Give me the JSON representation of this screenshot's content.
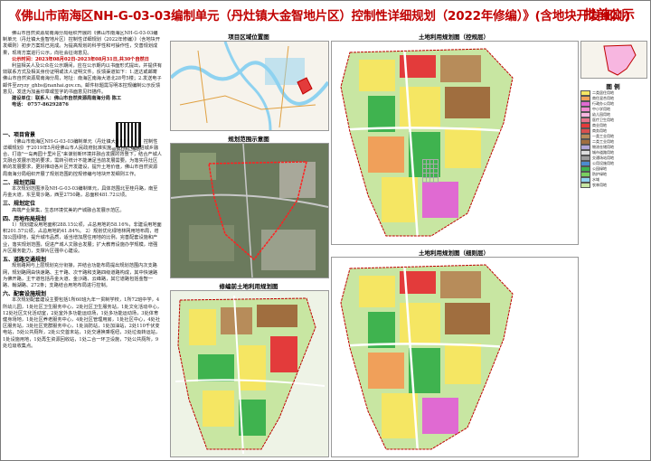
{
  "header": {
    "title": "《佛山市南海区NH-G-03-03编制单元（丹灶镇大金智地片区）控制性详细规划（2022年修编）》(含地块开发细则)",
    "badge": "批前公示"
  },
  "intro": {
    "p1": "佛山市自然资源局南海分局组织开展的《佛山市南海区NH-G-03-03编制单元（丹灶镇大金智地片区）控制性详细规划（2022年修编）》（含地块开发细则）初步方案现已完成。为提高规划的科学性和可操作性，交善规划成果，现将方案进行公示，向社会征询意见。",
    "notice_period": "公示时间：2023年08月02日-2023年08月31日,共30个自然日",
    "p2": "利益相关人及公众在公示期间，应在公示期内以书面形式提出，并提供有效联系方式及相关身份证明或法人证明文件。反馈渠道如下：1.送达或邮寄佛山市自然资源局南海分局，地址：南海区南海大道北28号5楼；2.发送电子邮件至zryzy_ghbs@nanhai.gov.cn。邮件标题需写明本控规编制公示反馈意见，发送为加盖印章或签字的书面意见扫描件。",
    "contact_label": "建设单位：",
    "contact_name": "联系人：",
    "contact_addr": "佛山市自然资源局南海分局   陈工",
    "contact_tel": "电话：   0757-86292876",
    "qr_label": "规划公示二维码"
  },
  "sections": [
    {
      "title": "一、项目背景",
      "text": "《佛山市南海区NH-G-03-03编制单元（丹灶镇大金智地片区）控制性详细规划》于2019年5月经佛山市人民政府批准实施。在丹灶镇推进城乡融合、打造\"一岛两园十里片区\"来谋划新环境并融合发展的背景下，结合产城人文融合发展示范的要求，需转引统计不能满足当前发展需要。为落实丹灶区新的发展要求，更好推动各片区开发建设，提升土地价值，佛山市自然资源局南海分局组织开展了规划范围的控规修编与地块开发细则工作。"
    },
    {
      "title": "二、规划范围",
      "text": "本次规划范围涉及NH-G-03-03编制单元，具体范围北至桂丹路，南至丹金大道，东至周沙路，西至2750路，总面积481.72公顷。"
    },
    {
      "title": "三、规划定位",
      "text": "高端产业聚集，生态环境优美的产城融合发展示范区。"
    },
    {
      "title": "四、用地布局规划",
      "text": "1）规划建设用地面积288.15公顷，占总用地的58.16%，非建设用地面积201.57公顷，占总用地的41.84%。 2）规划优化绿地林网用地布局，增加公园绿地，提升城市品质，适当增加居住用地的比例，完善配套设施和产业，落实规划范围，促进产城人文融合发展；扩大教育设施办学规模，增强片区服务能力，支撑片区强中心建设。"
    },
    {
      "title": "五、道路交通规划",
      "text": "规划路网与上层规划充分衔接，并结合功能布局提出规划范围内次支路网，规划路网由快速路、主干路、次干路和支路四级道路构成，其中快速路为佛开路，主干道包括丹金大道、金沙路、云峰路，其它道路包括金智一路、翰湖路、272条；支路结合用地布局进行控制。"
    },
    {
      "title": "六、配套设施规划",
      "text": "本次规划配套建设主要包括1所60班九年一贯制学校，1所72班中学，4所幼儿园，1处社区卫生服务中心，2处社区卫生服务站，1处文化活动中心，12处社区文化活动室，2处室外多功能运动场，1处多功能运动场，3处体育健身场地，1处社区养老服务中心，4处社区管理用房，1处社区中心，4处社区服务站，3处社区党群服务中心，1处消防站，1处加油站，2处110千伏变电站，5处公共厕所，2处公交首末站，1处交通换乘枢纽，3处垃圾转运站，1处设施用地，1处再生资源回收站，1处二合一环卫设施，7处公共厕所，9处垃圾收集点。"
    }
  ],
  "panels": {
    "location_title": "项目区域位置图",
    "scope_title": "规划范围示意图",
    "before_title": "修编前土地利用规划图",
    "control_title": "土地利用规划图（控规层）",
    "detail_title": "土地利用规划图（细则层）",
    "legend_title": "图  例"
  },
  "legend": [
    {
      "label": "二类居住用地",
      "color": "#f5e663"
    },
    {
      "label": "商住混合用地",
      "color": "#f0a05a"
    },
    {
      "label": "行政办公用地",
      "color": "#e06ad2"
    },
    {
      "label": "中小学用地",
      "color": "#f28bd0"
    },
    {
      "label": "幼儿园用地",
      "color": "#f7b6e0"
    },
    {
      "label": "医疗卫生用地",
      "color": "#e8748c"
    },
    {
      "label": "商业用地",
      "color": "#e33b3b"
    },
    {
      "label": "商务用地",
      "color": "#d9504f"
    },
    {
      "label": "一类工业用地",
      "color": "#b78c5a"
    },
    {
      "label": "二类工业用地",
      "color": "#a06e3f"
    },
    {
      "label": "物流仓储用地",
      "color": "#b0a6d8"
    },
    {
      "label": "城市道路用地",
      "color": "#dedede"
    },
    {
      "label": "交通场站用地",
      "color": "#9c9c9c"
    },
    {
      "label": "公用设施用地",
      "color": "#4c8bcf"
    },
    {
      "label": "公园绿地",
      "color": "#3fb34f"
    },
    {
      "label": "防护绿地",
      "color": "#7acf5f"
    },
    {
      "label": "水域",
      "color": "#8ed2f0"
    },
    {
      "label": "农林用地",
      "color": "#c8e6a2"
    }
  ],
  "colors": {
    "title": "#c00000",
    "residential": "#f5e663",
    "green": "#3fb34f",
    "industrial": "#b78c5a",
    "water": "#8ed2f0",
    "commercial": "#e33b3b",
    "road": "#ffffff"
  }
}
